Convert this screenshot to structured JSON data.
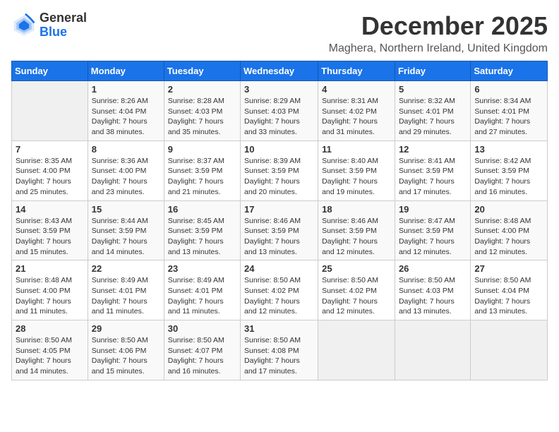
{
  "logo": {
    "line1": "General",
    "line2": "Blue"
  },
  "title": "December 2025",
  "location": "Maghera, Northern Ireland, United Kingdom",
  "days_of_week": [
    "Sunday",
    "Monday",
    "Tuesday",
    "Wednesday",
    "Thursday",
    "Friday",
    "Saturday"
  ],
  "weeks": [
    [
      {
        "day": "",
        "info": ""
      },
      {
        "day": "1",
        "info": "Sunrise: 8:26 AM\nSunset: 4:04 PM\nDaylight: 7 hours\nand 38 minutes."
      },
      {
        "day": "2",
        "info": "Sunrise: 8:28 AM\nSunset: 4:03 PM\nDaylight: 7 hours\nand 35 minutes."
      },
      {
        "day": "3",
        "info": "Sunrise: 8:29 AM\nSunset: 4:03 PM\nDaylight: 7 hours\nand 33 minutes."
      },
      {
        "day": "4",
        "info": "Sunrise: 8:31 AM\nSunset: 4:02 PM\nDaylight: 7 hours\nand 31 minutes."
      },
      {
        "day": "5",
        "info": "Sunrise: 8:32 AM\nSunset: 4:01 PM\nDaylight: 7 hours\nand 29 minutes."
      },
      {
        "day": "6",
        "info": "Sunrise: 8:34 AM\nSunset: 4:01 PM\nDaylight: 7 hours\nand 27 minutes."
      }
    ],
    [
      {
        "day": "7",
        "info": "Sunrise: 8:35 AM\nSunset: 4:00 PM\nDaylight: 7 hours\nand 25 minutes."
      },
      {
        "day": "8",
        "info": "Sunrise: 8:36 AM\nSunset: 4:00 PM\nDaylight: 7 hours\nand 23 minutes."
      },
      {
        "day": "9",
        "info": "Sunrise: 8:37 AM\nSunset: 3:59 PM\nDaylight: 7 hours\nand 21 minutes."
      },
      {
        "day": "10",
        "info": "Sunrise: 8:39 AM\nSunset: 3:59 PM\nDaylight: 7 hours\nand 20 minutes."
      },
      {
        "day": "11",
        "info": "Sunrise: 8:40 AM\nSunset: 3:59 PM\nDaylight: 7 hours\nand 19 minutes."
      },
      {
        "day": "12",
        "info": "Sunrise: 8:41 AM\nSunset: 3:59 PM\nDaylight: 7 hours\nand 17 minutes."
      },
      {
        "day": "13",
        "info": "Sunrise: 8:42 AM\nSunset: 3:59 PM\nDaylight: 7 hours\nand 16 minutes."
      }
    ],
    [
      {
        "day": "14",
        "info": "Sunrise: 8:43 AM\nSunset: 3:59 PM\nDaylight: 7 hours\nand 15 minutes."
      },
      {
        "day": "15",
        "info": "Sunrise: 8:44 AM\nSunset: 3:59 PM\nDaylight: 7 hours\nand 14 minutes."
      },
      {
        "day": "16",
        "info": "Sunrise: 8:45 AM\nSunset: 3:59 PM\nDaylight: 7 hours\nand 13 minutes."
      },
      {
        "day": "17",
        "info": "Sunrise: 8:46 AM\nSunset: 3:59 PM\nDaylight: 7 hours\nand 13 minutes."
      },
      {
        "day": "18",
        "info": "Sunrise: 8:46 AM\nSunset: 3:59 PM\nDaylight: 7 hours\nand 12 minutes."
      },
      {
        "day": "19",
        "info": "Sunrise: 8:47 AM\nSunset: 3:59 PM\nDaylight: 7 hours\nand 12 minutes."
      },
      {
        "day": "20",
        "info": "Sunrise: 8:48 AM\nSunset: 4:00 PM\nDaylight: 7 hours\nand 12 minutes."
      }
    ],
    [
      {
        "day": "21",
        "info": "Sunrise: 8:48 AM\nSunset: 4:00 PM\nDaylight: 7 hours\nand 11 minutes."
      },
      {
        "day": "22",
        "info": "Sunrise: 8:49 AM\nSunset: 4:01 PM\nDaylight: 7 hours\nand 11 minutes."
      },
      {
        "day": "23",
        "info": "Sunrise: 8:49 AM\nSunset: 4:01 PM\nDaylight: 7 hours\nand 11 minutes."
      },
      {
        "day": "24",
        "info": "Sunrise: 8:50 AM\nSunset: 4:02 PM\nDaylight: 7 hours\nand 12 minutes."
      },
      {
        "day": "25",
        "info": "Sunrise: 8:50 AM\nSunset: 4:02 PM\nDaylight: 7 hours\nand 12 minutes."
      },
      {
        "day": "26",
        "info": "Sunrise: 8:50 AM\nSunset: 4:03 PM\nDaylight: 7 hours\nand 13 minutes."
      },
      {
        "day": "27",
        "info": "Sunrise: 8:50 AM\nSunset: 4:04 PM\nDaylight: 7 hours\nand 13 minutes."
      }
    ],
    [
      {
        "day": "28",
        "info": "Sunrise: 8:50 AM\nSunset: 4:05 PM\nDaylight: 7 hours\nand 14 minutes."
      },
      {
        "day": "29",
        "info": "Sunrise: 8:50 AM\nSunset: 4:06 PM\nDaylight: 7 hours\nand 15 minutes."
      },
      {
        "day": "30",
        "info": "Sunrise: 8:50 AM\nSunset: 4:07 PM\nDaylight: 7 hours\nand 16 minutes."
      },
      {
        "day": "31",
        "info": "Sunrise: 8:50 AM\nSunset: 4:08 PM\nDaylight: 7 hours\nand 17 minutes."
      },
      {
        "day": "",
        "info": ""
      },
      {
        "day": "",
        "info": ""
      },
      {
        "day": "",
        "info": ""
      }
    ]
  ]
}
